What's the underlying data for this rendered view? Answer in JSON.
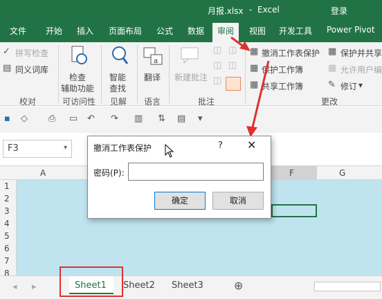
{
  "titlebar": {
    "filename": "月报.xlsx",
    "sep": "-",
    "app": "Excel",
    "login": "登录"
  },
  "tabs": [
    "文件",
    "开始",
    "插入",
    "页面布局",
    "公式",
    "数据",
    "审阅",
    "视图",
    "开发工具",
    "Power Pivot"
  ],
  "ribbon": {
    "proofing": {
      "spellcheck": "拼写检查",
      "thesaurus": "同义词库",
      "label": "校对"
    },
    "accessibility": {
      "check_line1": "检查",
      "check_line2": "辅助功能",
      "label": "可访问性"
    },
    "insights": {
      "smart_line1": "智能",
      "smart_line2": "查找",
      "label": "见解"
    },
    "language": {
      "translate": "翻译",
      "label": "语言"
    },
    "comments": {
      "new_comment": "新建批注",
      "label": "批注"
    },
    "changes": {
      "unprotect_sheet": "撤消工作表保护",
      "protect_workbook": "保护工作簿",
      "share_workbook": "共享工作簿",
      "protect_share": "保护并共享",
      "allow_users": "允许用户编",
      "track": "修订",
      "label": "更改"
    }
  },
  "namebox": "F3",
  "columns": [
    "A",
    "F",
    "G"
  ],
  "rows": [
    "1",
    "2",
    "3",
    "4",
    "5",
    "6",
    "7",
    "8"
  ],
  "sheets": [
    "Sheet1",
    "Sheet2",
    "Sheet3"
  ],
  "dialog": {
    "title": "撤消工作表保护",
    "help": "?",
    "password_label": "密码(P):",
    "password_value": "",
    "ok": "确定",
    "cancel": "取消"
  },
  "colors": {
    "excel_green": "#217346",
    "annotation_red": "#e03030",
    "sheet_bg": "#bfe4ef"
  }
}
